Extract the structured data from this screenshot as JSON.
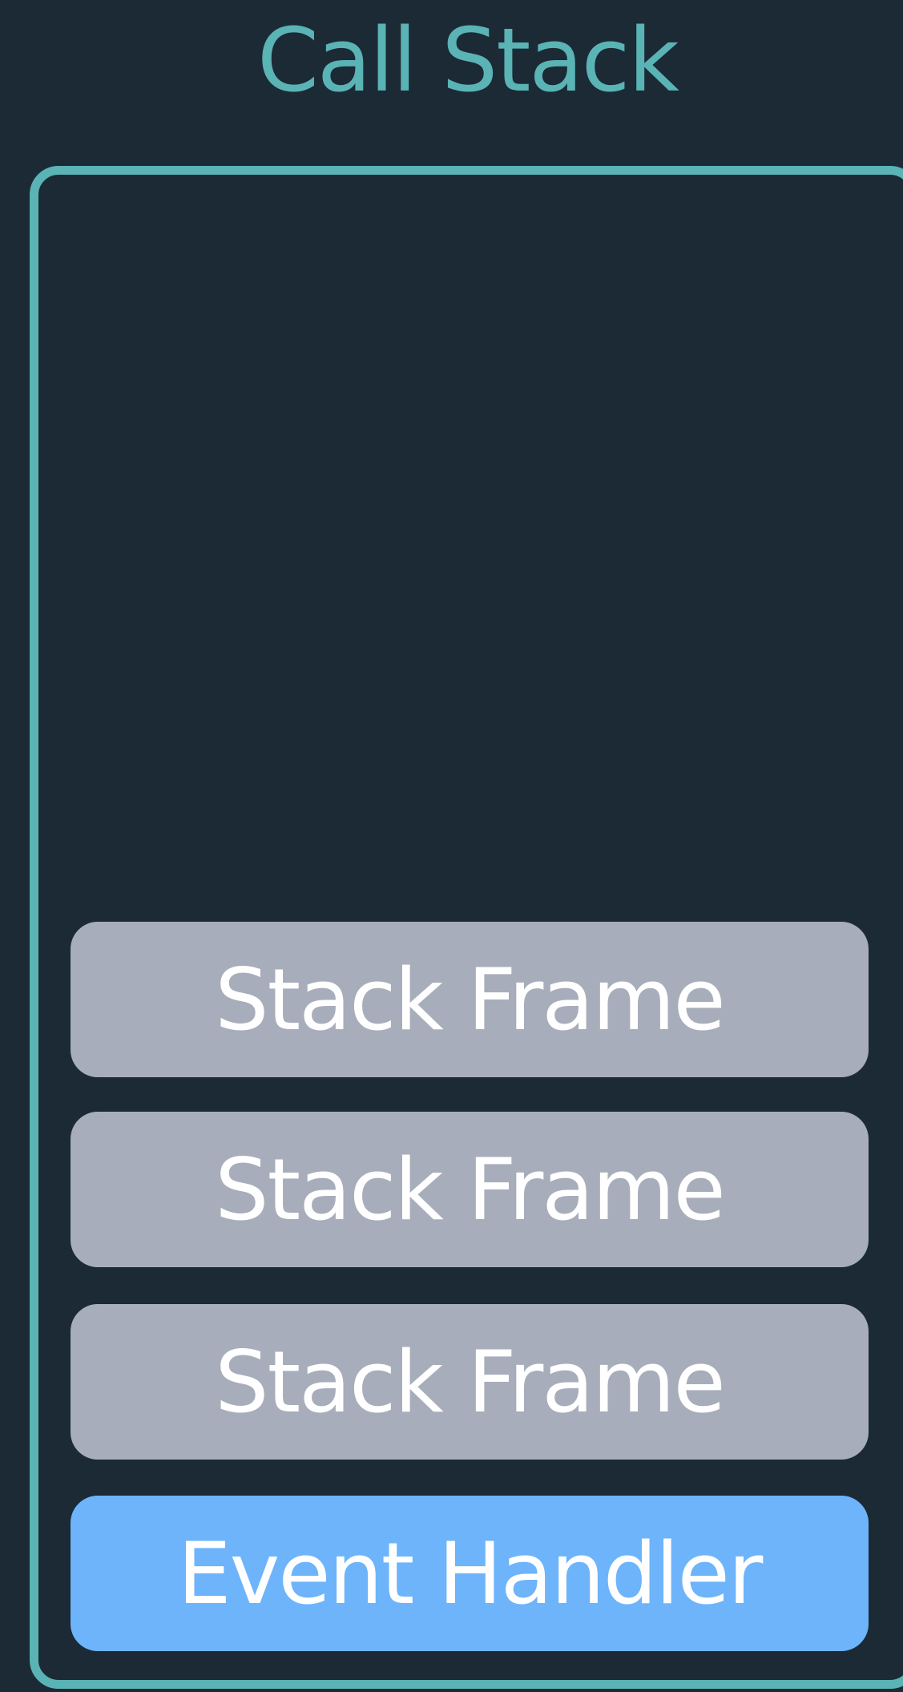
{
  "title": "Call Stack",
  "frames": [
    {
      "label": "Stack Frame",
      "kind": "stack-frame"
    },
    {
      "label": "Stack Frame",
      "kind": "stack-frame"
    },
    {
      "label": "Stack Frame",
      "kind": "stack-frame"
    },
    {
      "label": "Event Handler",
      "kind": "event-handler"
    }
  ],
  "colors": {
    "background": "#1c2a35",
    "accent": "#5ab3b4",
    "stack_frame": "#a7adba",
    "event_handler": "#6db4fb",
    "text": "#ffffff"
  }
}
